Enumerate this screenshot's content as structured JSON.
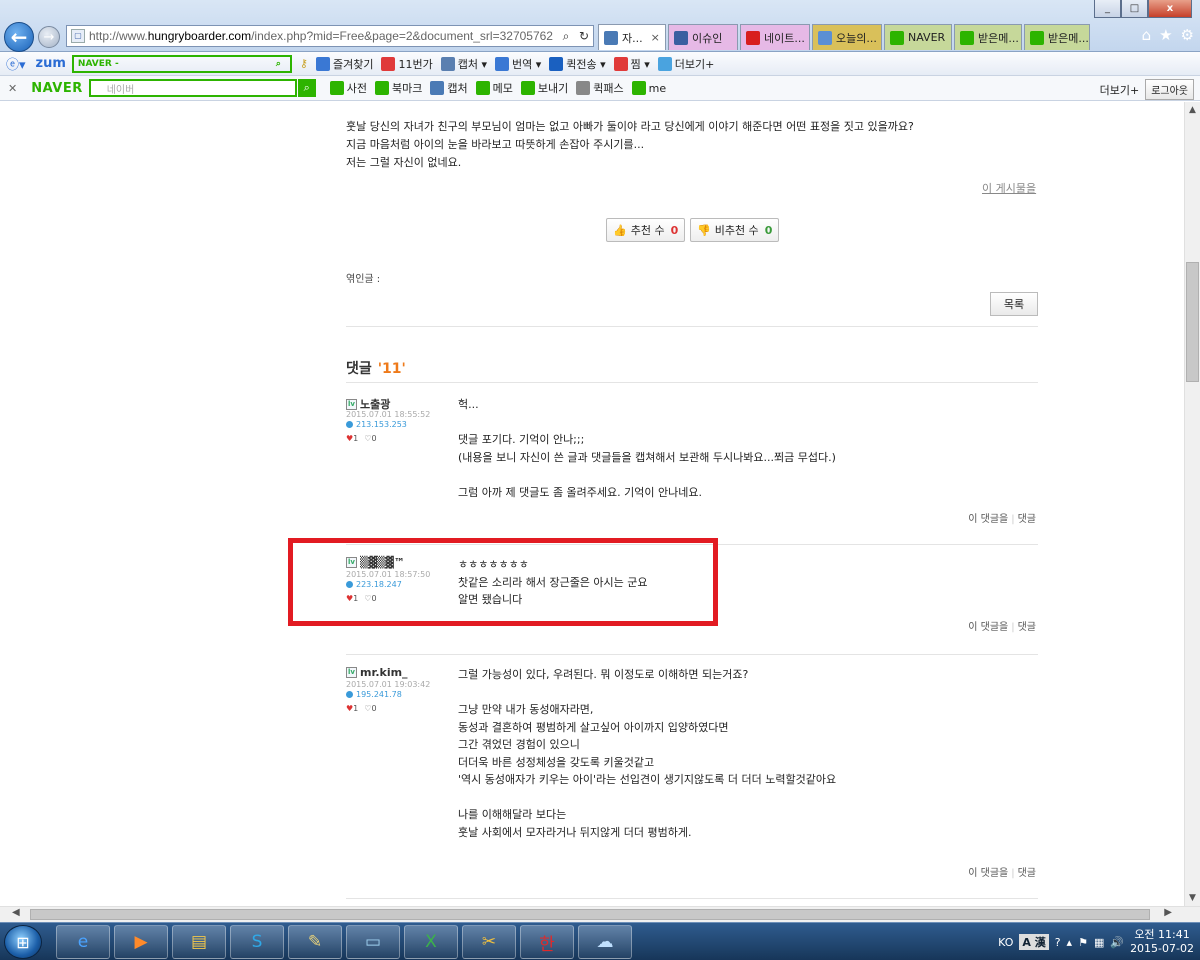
{
  "window": {
    "minimize": "_",
    "maximize": "□",
    "close": "x"
  },
  "address_bar": {
    "url_prefix": "http://www.",
    "url_domain": "hungryboarder.com",
    "url_rest": "/index.php?mid=Free&page=2&document_srl=32705762"
  },
  "tabs": [
    {
      "label": "자...",
      "icon_color": "#4a7ab5",
      "active": true
    },
    {
      "label": "이슈인",
      "icon_color": "#3a5fa0",
      "bg": "#e6b9e6"
    },
    {
      "label": "네이트...",
      "icon_color": "#d81e1e",
      "bg": "#e6b9e6"
    },
    {
      "label": "오늘의...",
      "icon_color": "#5b8fd4",
      "bg": "#d9c05a"
    },
    {
      "label": "NAVER",
      "icon_color": "#2db400",
      "bg": "#c6d89a"
    },
    {
      "label": "받은메...",
      "icon_color": "#2db400",
      "bg": "#c6d89a"
    },
    {
      "label": "받은메...",
      "icon_color": "#2db400",
      "bg": "#c6d89a"
    }
  ],
  "toolbar1": {
    "zum": "zum",
    "naver_box": "NAVER -",
    "items": [
      {
        "label": "즐겨찾기",
        "icon": "star-icon",
        "color": "#3a78d4"
      },
      {
        "label": "11번가",
        "icon": "shop-icon",
        "color": "#e03a3a"
      },
      {
        "label": "캡처 ▾",
        "icon": "capture-icon",
        "color": "#5a7fb0"
      },
      {
        "label": "번역 ▾",
        "icon": "translate-icon",
        "color": "#3a78d4"
      },
      {
        "label": "퀵전송 ▾",
        "icon": "send-icon",
        "color": "#1a60c0"
      },
      {
        "label": "찜 ▾",
        "icon": "heart-icon",
        "color": "#e03a3a"
      },
      {
        "label": "더보기+",
        "icon": "twitter-icon",
        "color": "#4aa3df"
      }
    ]
  },
  "toolbar2": {
    "naver": "NAVER",
    "search_placeholder": "네이버",
    "items": [
      {
        "label": "사전",
        "icon": "dictionary-icon",
        "color": "#2db400"
      },
      {
        "label": "북마크",
        "icon": "bookmark-star-icon",
        "color": "#2db400"
      },
      {
        "label": "캡처",
        "icon": "capture-icon",
        "color": "#4a7ab5"
      },
      {
        "label": "메모",
        "icon": "memo-icon",
        "color": "#2db400"
      },
      {
        "label": "보내기",
        "icon": "share-icon",
        "color": "#2db400"
      },
      {
        "label": "퀵패스",
        "icon": "key-icon",
        "color": "#888888"
      },
      {
        "label": "me",
        "icon": "me-icon",
        "color": "#2db400"
      }
    ],
    "more": "더보기+",
    "login": "로그아웃"
  },
  "post": {
    "lines": [
      "훗날  당신의 자녀가 친구의 부모님이 엄마는 없고 아빠가 둘이야 라고 당신에게 이야기 해준다면  어떤 표정을 짓고 있을까요?",
      "지금 마음처럼 아이의 눈을 바라보고 따뜻하게 손잡아 주시기를...",
      "저는 그럴 자신이 없네요."
    ],
    "this_post": "이 게시물을",
    "recommend_label": "추천 수",
    "recommend_count": "0",
    "not_recommend_label": "비추천 수",
    "not_recommend_count": "0",
    "trackback": "엮인글 :",
    "list_button": "목록"
  },
  "comments_header": {
    "label": "댓글",
    "count": "'11'"
  },
  "comments": [
    {
      "author": "노출광",
      "date": "2015.07.01 18:55:52",
      "ip": "213.153.253",
      "likes": "1",
      "dislikes": "0",
      "body": "헉...\n\n댓글 포기다.  기억이 안나;;;\n(내용을 보니 자신이 쓴 글과  댓글들을 캡쳐해서 보관해 두시나봐요...쬐금 무섭다.)\n\n그럼 아까 제 댓글도 좀 올려주세요.  기억이 안나네요.",
      "action_this": "이 댓글을",
      "action_reply": "댓글"
    },
    {
      "author": "▒▓▒▓™",
      "date": "2015.07.01 18:57:50",
      "ip": "223.18.247",
      "likes": "1",
      "dislikes": "0",
      "body": "ㅎㅎㅎㅎㅎㅎㅎ\n찻같은 소리라 해서 장근줄은 아시는 군요\n알면 됐습니다",
      "action_this": "이 댓글을",
      "action_reply": "댓글"
    },
    {
      "author": "mr.kim_",
      "date": "2015.07.01 19:03:42",
      "ip": "195.241.78",
      "likes": "1",
      "dislikes": "0",
      "body": "그럴 가능성이 있다, 우려된다. 뭐 이정도로 이해하면 되는거죠?\n\n그냥 만약 내가 동성애자라면,\n동성과 결혼하여 평범하게 살고싶어 아이까지 입양하였다면\n그간 겪었던 경험이 있으니\n더더욱 바른 성정체성을 갖도록 키울것같고\n'역시 동성애자가 키우는 아이'라는 선입견이 생기지않도록 더 더더 노력할것같아요\n\n나를 이해해달라 보다는\n훗날 사회에서 모자라거나 뒤지않게 더더 평범하게.",
      "action_this": "이 댓글을",
      "action_reply": "댓글"
    }
  ],
  "taskbar": {
    "lang": "KO",
    "ime": "A 漢",
    "time": "오전 11:41",
    "date": "2015-07-02"
  }
}
